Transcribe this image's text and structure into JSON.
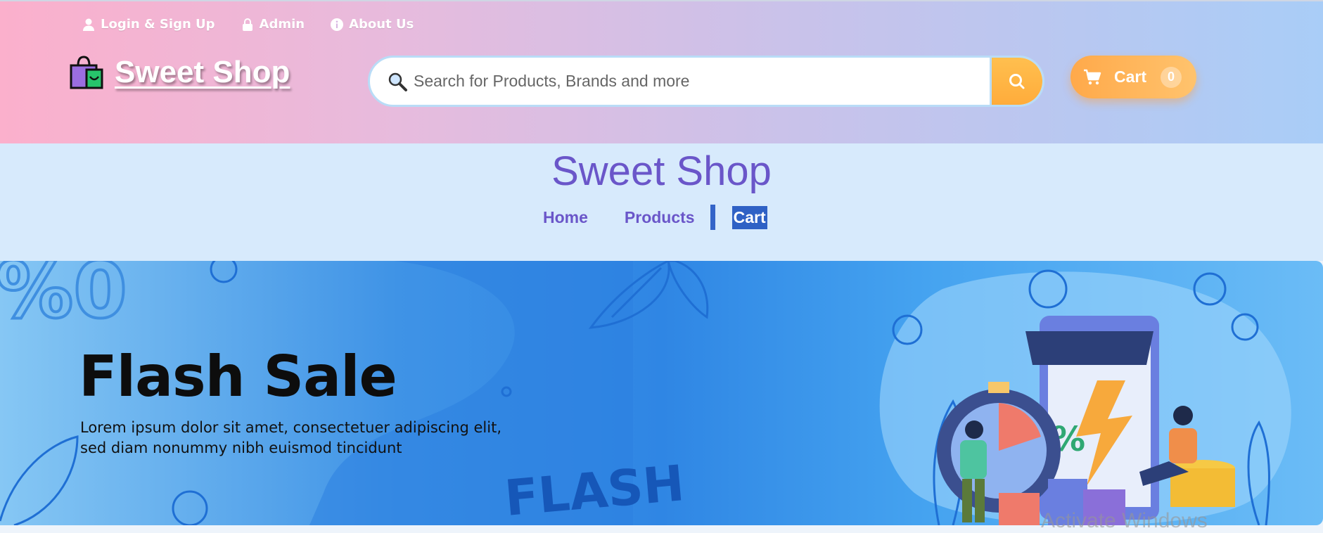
{
  "top_links": [
    {
      "label": "Login & Sign Up",
      "icon": "user-icon"
    },
    {
      "label": "Admin",
      "icon": "lock-icon"
    },
    {
      "label": "About Us",
      "icon": "info-icon"
    }
  ],
  "logo": {
    "text": "Sweet Shop",
    "icon": "shopping-bag-icon"
  },
  "search": {
    "placeholder": "Search for Products, Brands and more",
    "value": ""
  },
  "cart_button": {
    "label": "Cart",
    "count": "0"
  },
  "site_title": "Sweet Shop",
  "nav": {
    "items": [
      "Home",
      "Products",
      "Cart"
    ],
    "active": "Cart"
  },
  "banner": {
    "title": "Flash Sale",
    "subtitle": "Lorem ipsum dolor sit amet, consectetuer adipiscing elit, sed diam nonummy nibh euismod tincidunt",
    "badge": "FLASH"
  },
  "watermark": "Activate Windows",
  "colors": {
    "accent": "#6a56c9",
    "nav_active_bg": "#2f61c5",
    "cart_orange": "#ffac3b",
    "banner_blue": "#2f86e4"
  }
}
